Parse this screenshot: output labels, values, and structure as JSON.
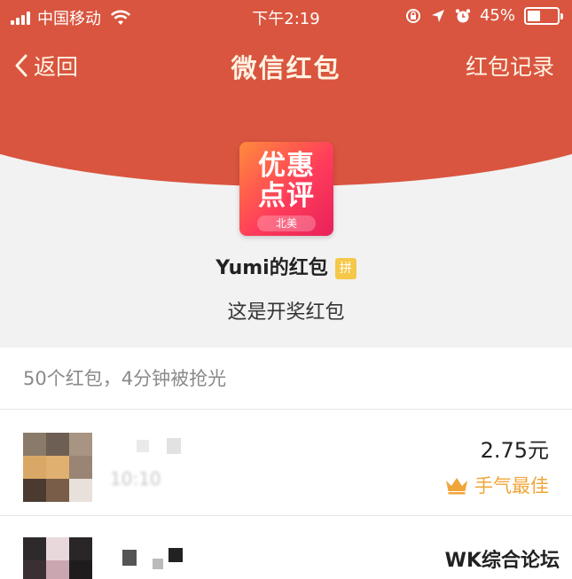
{
  "status_bar": {
    "carrier": "中国移动",
    "time": "下午2:19",
    "battery": "45%",
    "battery_level": 0.45
  },
  "nav": {
    "back_label": "返回",
    "title": "微信红包",
    "records_label": "红包记录"
  },
  "logo": {
    "line1": "优惠",
    "line2": "点评",
    "sub": "北美"
  },
  "envelope": {
    "sender": "Yumi的红包",
    "badge": "拼",
    "greeting": "这是开奖红包"
  },
  "summary": "50个红包，4分钟被抢光",
  "entries": [
    {
      "time": "10:10",
      "amount": "2.75元",
      "best_label": "手气最佳"
    }
  ],
  "watermark": "WK综合论坛",
  "colors": {
    "header_red": "#d9553f",
    "best_gold": "#f0a53a"
  }
}
